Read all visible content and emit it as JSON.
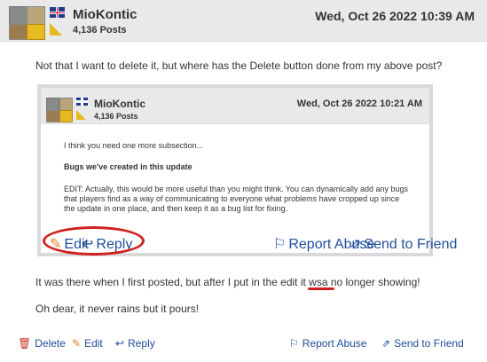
{
  "post": {
    "username": "MioKontic",
    "post_count": "4,136 Posts",
    "date": "Wed, Oct 26 2022 10:39 AM",
    "body": [
      "Not that I want to delete it, but where has the Delete button done from my above post?",
      "It was there when I first posted, but after I put in the edit it wsa no longer showing!",
      "Oh dear, it never rains but it pours!"
    ],
    "actions": {
      "delete": "Delete",
      "edit": "Edit",
      "reply": "Reply",
      "report_abuse": "Report Abuse",
      "send_to_friend": "Send to Friend"
    }
  },
  "quoted_screenshot": {
    "username": "MioKontic",
    "post_count": "4,136 Posts",
    "date": "Wed, Oct 26 2022 10:21 AM",
    "lines": [
      "I think you need one more subsection...",
      "Bugs we've created in this update",
      "EDIT:  Actually, this would be more useful than you might think.  You can dynamically add any bugs that players find as a way of communicating to everyone what problems have cropped up since the update in one place, and then keep it as a bug list for fixing."
    ],
    "actions": {
      "edit": "Edit",
      "reply": "Reply",
      "report_abuse": "Report Abuse",
      "send_to_friend": "Send to Friend"
    }
  },
  "icons": {
    "flag": "uk-flag-icon",
    "rank": "rank-badge-icon",
    "delete": "trash-icon",
    "edit": "pencil-icon",
    "reply": "reply-arrow-icon",
    "report": "flag-outline-icon",
    "send": "share-icon"
  },
  "colors": {
    "link": "#1f4e9a",
    "annotation": "#d12020",
    "header_bg": "#e9e9e9"
  }
}
